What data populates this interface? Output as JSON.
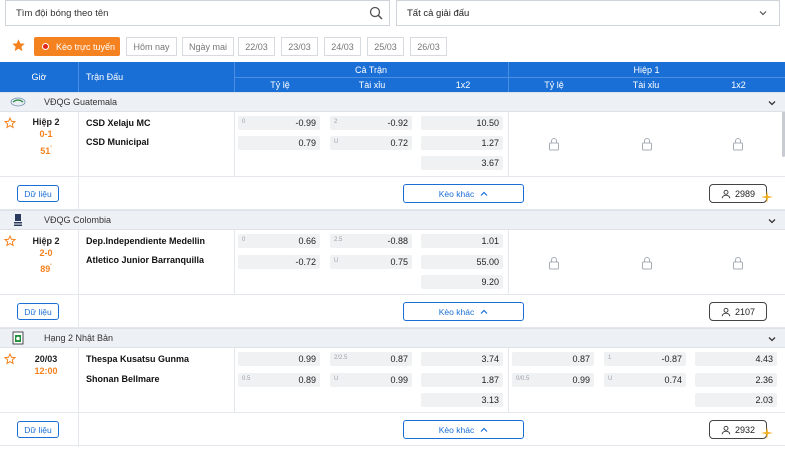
{
  "search": {
    "placeholder": "Tìm đội bóng theo tên"
  },
  "league_select": {
    "value": "Tất cả giải đấu"
  },
  "filters": {
    "live_label": "Kèo trực tuyến",
    "days": [
      "Hôm nay",
      "Ngày mai",
      "22/03",
      "23/03",
      "24/03",
      "25/03",
      "26/03"
    ]
  },
  "header": {
    "time": "Giờ",
    "match": "Trận Đấu",
    "full_match": "Cả Trận",
    "half1": "Hiệp 1",
    "handicap": "Tỷ lệ",
    "over_under": "Tài xỉu",
    "one_x_two": "1x2"
  },
  "colors": {
    "brand_blue": "#1a6fd7",
    "orange": "#f58220",
    "score_orange": "#f5821f"
  },
  "leagues": [
    {
      "name": "VĐQG Guatemala",
      "match": {
        "period": "Hiệp 2",
        "score": "0-1",
        "minute": "51",
        "minute_mark": "'",
        "home": "CSD Xelaju MC",
        "away": "CSD Municipal",
        "ft_hdp": {
          "l1": "0",
          "v1": "-0.99",
          "l2": "",
          "v2": "0.79"
        },
        "ft_ou": {
          "l1": "2",
          "v1": "-0.92",
          "l2": "U",
          "v2": "0.72"
        },
        "ft_1x2": [
          "10.50",
          "1.27",
          "3.67"
        ],
        "comments": "2989"
      }
    },
    {
      "name": "VĐQG Colombia",
      "match": {
        "period": "Hiệp 2",
        "score": "2-0",
        "minute": "89",
        "minute_mark": "'",
        "home": "Dep.Independiente Medellin",
        "away": "Atletico Junior Barranquilla",
        "ft_hdp": {
          "l1": "0",
          "v1": "0.66",
          "l2": "",
          "v2": "-0.72"
        },
        "ft_ou": {
          "l1": "2.5",
          "v1": "-0.88",
          "l2": "U",
          "v2": "0.75"
        },
        "ft_1x2": [
          "1.01",
          "55.00",
          "9.20"
        ],
        "comments": "2107"
      }
    },
    {
      "name": "Hạng 2 Nhật Bản",
      "match": {
        "date": "20/03",
        "time": "12:00",
        "home": "Thespa Kusatsu Gunma",
        "away": "Shonan Bellmare",
        "ft_hdp": {
          "l1": "",
          "v1": "0.99",
          "l2": "0.5",
          "v2": "0.89"
        },
        "ft_ou": {
          "l1": "2/2.5",
          "v1": "0.87",
          "l2": "U",
          "v2": "0.99"
        },
        "ft_1x2": [
          "3.74",
          "1.87",
          "3.13"
        ],
        "h1_hdp": {
          "l1": "",
          "v1": "0.87",
          "l2": "0/0.5",
          "v2": "0.99"
        },
        "h1_ou": {
          "l1": "1",
          "v1": "-0.87",
          "l2": "U",
          "v2": "0.74"
        },
        "h1_1x2": [
          "4.43",
          "2.36",
          "2.03"
        ],
        "comments": "2932"
      }
    }
  ],
  "footer": {
    "data_label": "Dữ liệu",
    "more_label": "Kèo khác"
  }
}
